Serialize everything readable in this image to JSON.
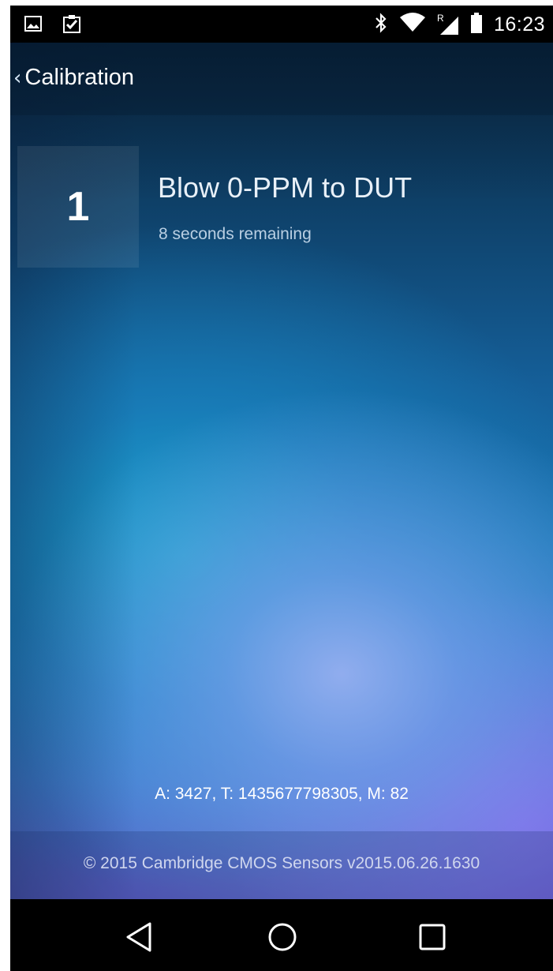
{
  "status_bar": {
    "time": "16:23",
    "left_icons": [
      "gallery-icon",
      "clipboard-check-icon"
    ],
    "right_icons": [
      "bluetooth-icon",
      "wifi-icon",
      "cell-signal-roaming-icon",
      "battery-icon"
    ],
    "roaming_label": "R"
  },
  "header": {
    "back_chevron": "‹",
    "title": "Calibration"
  },
  "step": {
    "number": "1",
    "title": "Blow 0-PPM to DUT",
    "subtitle": "8 seconds remaining"
  },
  "sensor_readout": "A: 3427, T: 1435677798305, M: 82",
  "footer": {
    "text": "© 2015 Cambridge CMOS Sensors v2015.06.26.1630"
  },
  "nav_bar": {
    "buttons": [
      "back-nav-icon",
      "home-nav-icon",
      "recents-nav-icon"
    ]
  }
}
